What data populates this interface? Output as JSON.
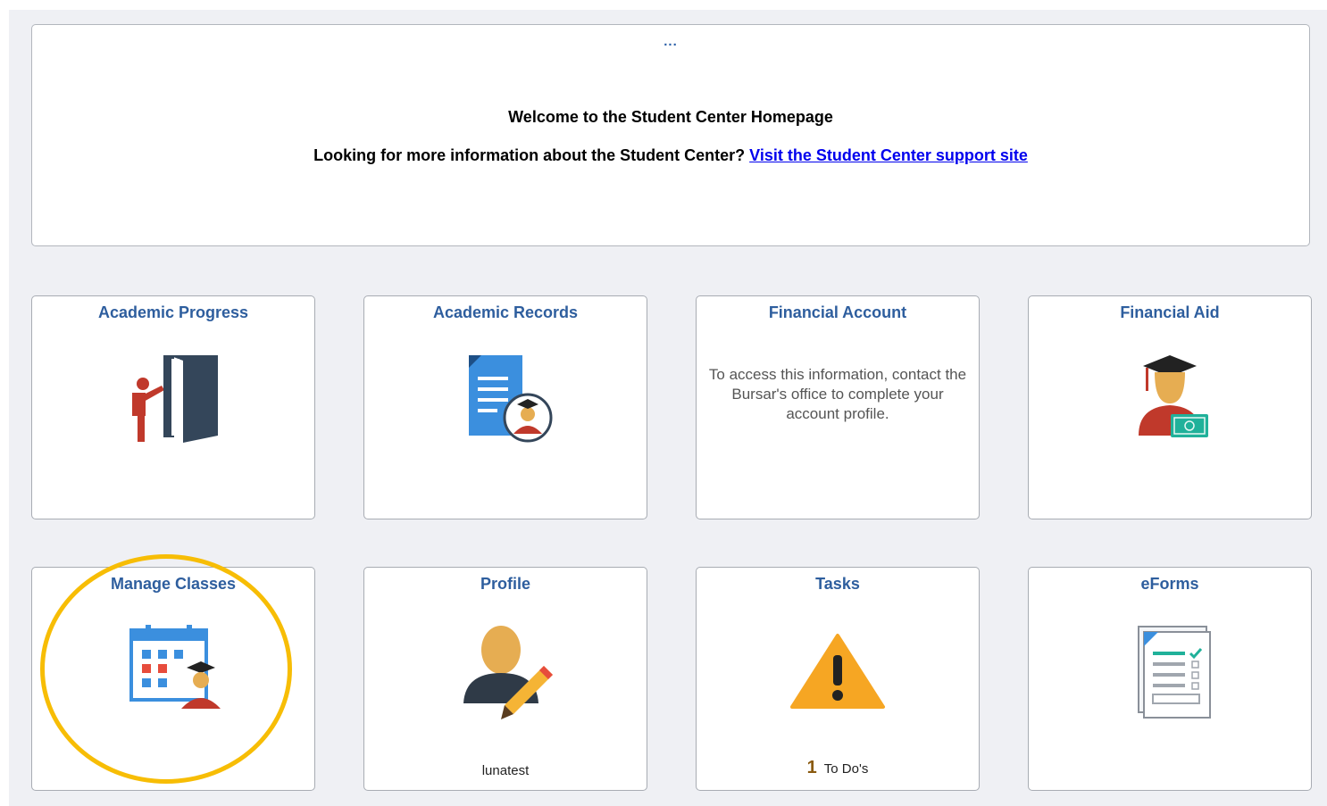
{
  "banner": {
    "more": "...",
    "welcome": "Welcome to the Student Center Homepage",
    "info_text": "Looking for more information about the Student Center?",
    "info_link": "Visit the Student Center support site"
  },
  "tiles": [
    {
      "title": "Academic Progress",
      "icon": "presenter-door-icon"
    },
    {
      "title": "Academic Records",
      "icon": "document-graduate-icon"
    },
    {
      "title": "Financial Account",
      "message": "To access this information, contact the Bursar's office to complete your account profile."
    },
    {
      "title": "Financial Aid",
      "icon": "graduate-money-icon"
    },
    {
      "title": "Manage Classes",
      "icon": "calendar-graduate-icon"
    },
    {
      "title": "Profile",
      "icon": "person-pencil-icon",
      "footer": "lunatest"
    },
    {
      "title": "Tasks",
      "icon": "warning-icon",
      "count": "1",
      "footer": "To Do's"
    },
    {
      "title": "eForms",
      "icon": "forms-checklist-icon"
    }
  ],
  "colors": {
    "accent": "#2e5e9e",
    "highlight": "#f7bd05",
    "warning": "#f6a623",
    "link": "#0000ee"
  }
}
